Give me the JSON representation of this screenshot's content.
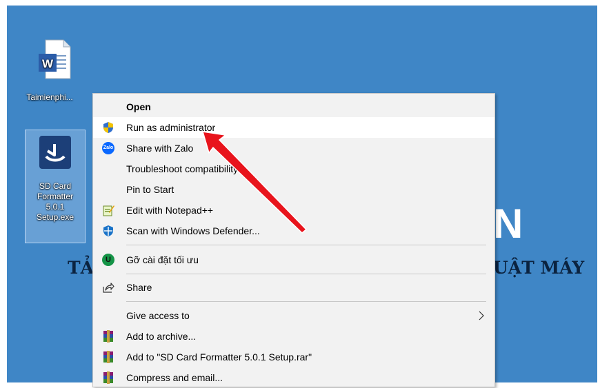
{
  "desktop": {
    "bg_color": "#3f86c6",
    "watermark_big": "N",
    "watermark_left": "TẢ",
    "watermark_right": "UẬT MÁY",
    "icons": [
      {
        "label": "Taimienphi...",
        "icon": "word-document-icon"
      },
      {
        "label_lines": [
          "SD Card",
          "Formatter",
          "5.0.1",
          "Setup.exe"
        ],
        "icon": "sd-card-formatter-icon",
        "selected": true
      }
    ]
  },
  "context_menu": {
    "items": [
      {
        "label": "Open",
        "bold": true
      },
      {
        "label": "Run as administrator",
        "icon": "uac-shield-icon",
        "highlighted": true
      },
      {
        "label": "Share with Zalo",
        "icon": "zalo-icon"
      },
      {
        "label": "Troubleshoot compatibility"
      },
      {
        "label": "Pin to Start"
      },
      {
        "label": "Edit with Notepad++",
        "icon": "notepad-plus-plus-icon"
      },
      {
        "label": "Scan with Windows Defender...",
        "icon": "windows-defender-icon"
      },
      {
        "label": "Gỡ cài đặt tối ưu",
        "icon": "uninstaller-icon"
      },
      {
        "label": "Share",
        "icon": "share-icon"
      },
      {
        "label": "Give access to",
        "submenu": true
      },
      {
        "label": "Add to archive...",
        "icon": "winrar-icon"
      },
      {
        "label": "Add to \"SD Card Formatter 5.0.1 Setup.rar\"",
        "icon": "winrar-icon"
      },
      {
        "label": "Compress and email...",
        "icon": "winrar-icon"
      }
    ]
  },
  "annotation": {
    "arrow": "red-arrow-pointing-to-run-as-administrator",
    "color": "#e8141c"
  }
}
